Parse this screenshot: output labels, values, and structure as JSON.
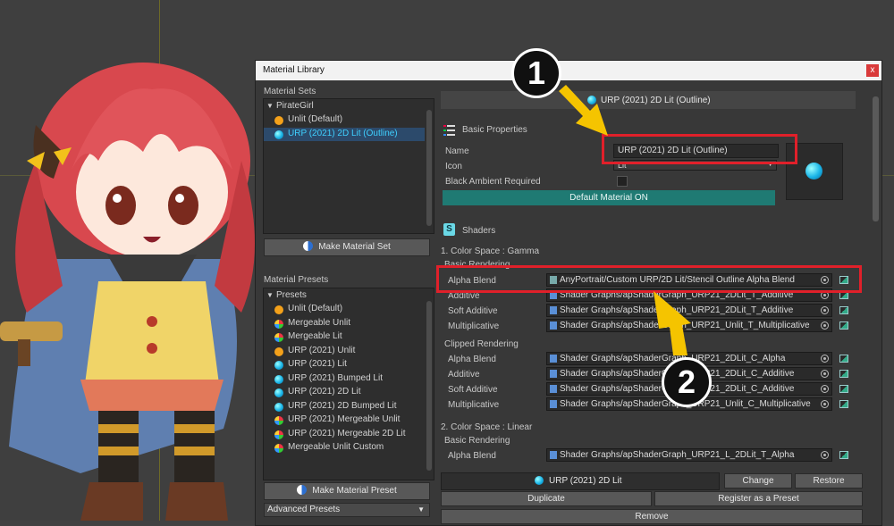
{
  "window": {
    "title": "Material Library",
    "close": "x"
  },
  "material_sets": {
    "header": "Material Sets",
    "root": "PirateGirl",
    "items": [
      {
        "label": "Unlit (Default)",
        "icon": "orange-dot-icon"
      },
      {
        "label": "URP (2021) 2D Lit (Outline)",
        "icon": "cyan-sphere-icon",
        "selected": true
      }
    ],
    "make_button": "Make Material Set"
  },
  "material_presets": {
    "header": "Material Presets",
    "root": "Presets",
    "items": [
      {
        "label": "Unlit (Default)",
        "icon": "orange"
      },
      {
        "label": "Mergeable Unlit",
        "icon": "multi"
      },
      {
        "label": "Mergeable Lit",
        "icon": "multi"
      },
      {
        "label": "URP (2021) Unlit",
        "icon": "orange"
      },
      {
        "label": "URP (2021) Lit",
        "icon": "cyan"
      },
      {
        "label": "URP (2021) Bumped Lit",
        "icon": "cyan"
      },
      {
        "label": "URP (2021) 2D Lit",
        "icon": "cyan"
      },
      {
        "label": "URP (2021) 2D Bumped Lit",
        "icon": "cyan"
      },
      {
        "label": "URP (2021) Mergeable Unlit",
        "icon": "multi"
      },
      {
        "label": "URP (2021) Mergeable 2D Lit",
        "icon": "multi"
      },
      {
        "label": "Mergeable Unlit Custom",
        "icon": "multi"
      }
    ],
    "make_button": "Make Material Preset",
    "advanced": "Advanced Presets"
  },
  "inspector": {
    "header": "URP (2021) 2D Lit (Outline)",
    "basic_properties": "Basic Properties",
    "name_label": "Name",
    "name_value": "URP (2021) 2D Lit (Outline)",
    "icon_label": "Icon",
    "icon_value": "Lit",
    "black_ambient_label": "Black Ambient Required",
    "default_material_button": "Default Material ON",
    "shaders_label": "Shaders",
    "gamma_section": "1. Color Space : Gamma",
    "basic_rendering": "Basic Rendering",
    "gamma_basic": [
      {
        "label": "Alpha Blend",
        "value": "AnyPortrait/Custom URP/2D Lit/Stencil Outline Alpha Blend"
      },
      {
        "label": "Additive",
        "value": "Shader Graphs/apShaderGraph_URP21_2DLit_T_Additive"
      },
      {
        "label": "Soft Additive",
        "value": "Shader Graphs/apShaderGraph_URP21_2DLit_T_Additive"
      },
      {
        "label": "Multiplicative",
        "value": "Shader Graphs/apShaderGraph_URP21_Unlit_T_Multiplicative"
      }
    ],
    "clipped_rendering": "Clipped Rendering",
    "gamma_clipped": [
      {
        "label": "Alpha Blend",
        "value": "Shader Graphs/apShaderGraph_URP21_2DLit_C_Alpha"
      },
      {
        "label": "Additive",
        "value": "Shader Graphs/apShaderGraph_URP21_2DLit_C_Additive"
      },
      {
        "label": "Soft Additive",
        "value": "Shader Graphs/apShaderGraph_URP21_2DLit_C_Additive"
      },
      {
        "label": "Multiplicative",
        "value": "Shader Graphs/apShaderGraph_URP21_Unlit_C_Multiplicative"
      }
    ],
    "linear_section": "2. Color Space : Linear",
    "linear_basic_rendering": "Basic Rendering",
    "linear_basic": [
      {
        "label": "Alpha Blend",
        "value": "Shader Graphs/apShaderGraph_URP21_L_2DLit_T_Alpha"
      }
    ]
  },
  "footer": {
    "current": "URP (2021) 2D Lit",
    "change": "Change",
    "restore": "Restore",
    "duplicate": "Duplicate",
    "register": "Register as a Preset",
    "remove": "Remove"
  },
  "callouts": {
    "one": "1",
    "two": "2"
  },
  "colors": {
    "highlight": "#e0202a",
    "arrow": "#f5c400",
    "accent": "#3fd0ff"
  }
}
